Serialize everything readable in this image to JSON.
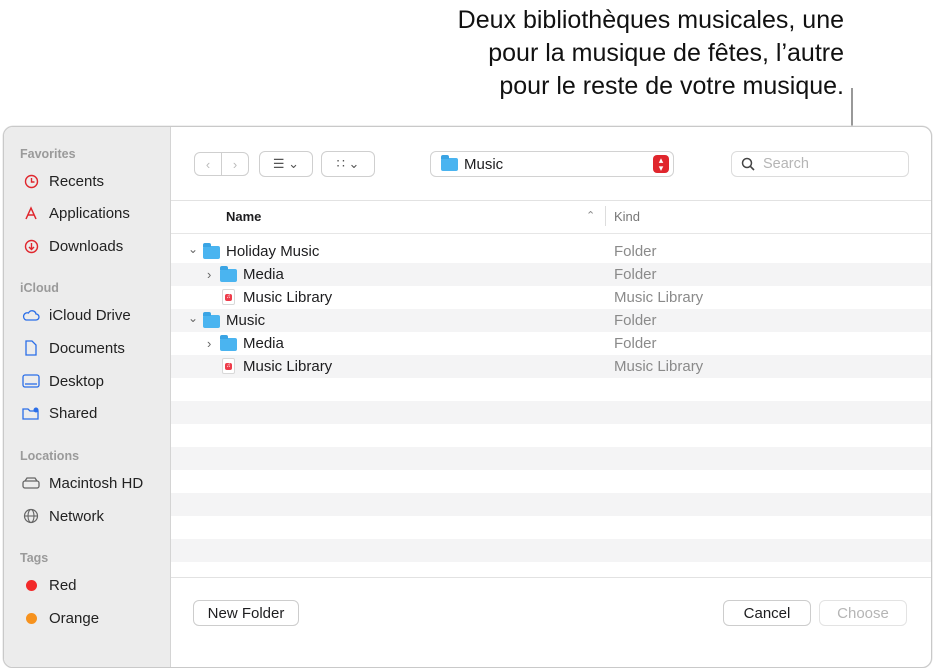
{
  "callout": {
    "line1": "Deux bibliothèques musicales, une",
    "line2": "pour la musique de fêtes, l’autre",
    "line3": "pour le reste de votre musique."
  },
  "sidebar": {
    "favorites_heading": "Favorites",
    "favorites": [
      {
        "label": "Recents",
        "icon": "clock-icon"
      },
      {
        "label": "Applications",
        "icon": "applications-icon"
      },
      {
        "label": "Downloads",
        "icon": "download-icon"
      }
    ],
    "icloud_heading": "iCloud",
    "icloud": [
      {
        "label": "iCloud Drive",
        "icon": "cloud-icon"
      },
      {
        "label": "Documents",
        "icon": "document-icon"
      },
      {
        "label": "Desktop",
        "icon": "desktop-icon"
      },
      {
        "label": "Shared",
        "icon": "shared-folder-icon"
      }
    ],
    "locations_heading": "Locations",
    "locations": [
      {
        "label": "Macintosh HD",
        "icon": "disk-icon"
      },
      {
        "label": "Network",
        "icon": "globe-icon"
      }
    ],
    "tags_heading": "Tags",
    "tags": [
      {
        "label": "Red",
        "color": "#f22a2a"
      },
      {
        "label": "Orange",
        "color": "#f6921e"
      }
    ]
  },
  "toolbar": {
    "location": "Music",
    "search_placeholder": "Search"
  },
  "columns": {
    "name": "Name",
    "kind": "Kind"
  },
  "rows": [
    {
      "name": "Holiday Music",
      "kind": "Folder"
    },
    {
      "name": "Media",
      "kind": "Folder"
    },
    {
      "name": "Music Library",
      "kind": "Music Library"
    },
    {
      "name": "Music",
      "kind": "Folder"
    },
    {
      "name": "Media",
      "kind": "Folder"
    },
    {
      "name": "Music Library",
      "kind": "Music Library"
    }
  ],
  "footer": {
    "new_folder": "New Folder",
    "cancel": "Cancel",
    "choose": "Choose"
  }
}
